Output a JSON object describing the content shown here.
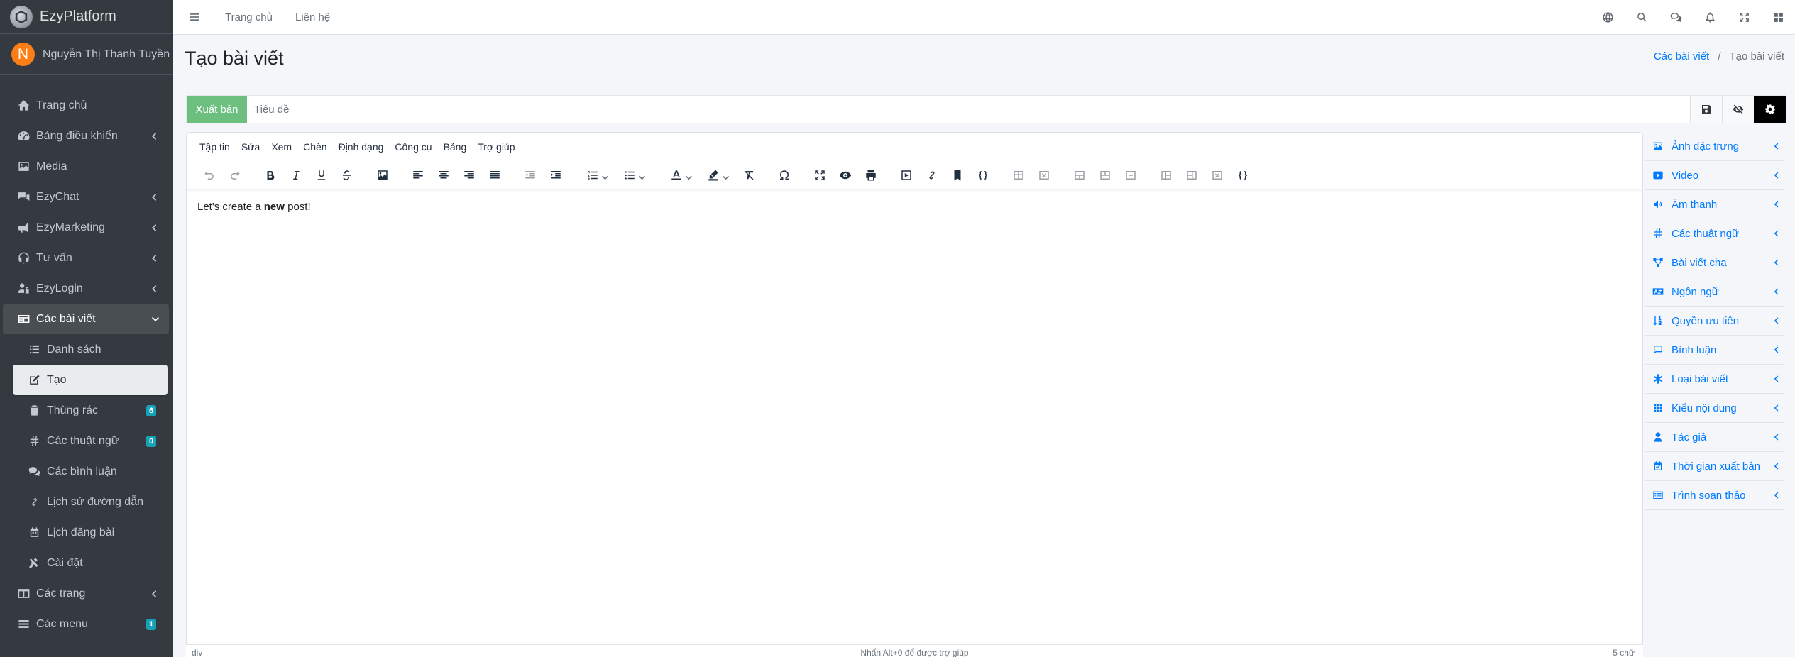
{
  "brand": {
    "name": "EzyPlatform"
  },
  "user": {
    "initial": "N",
    "name": "Nguyễn Thị Thanh Tuyền"
  },
  "sidebar": {
    "items": [
      {
        "label": "Trang chủ",
        "icon": "home-icon"
      },
      {
        "label": "Bảng điều khiển",
        "icon": "dashboard-icon"
      },
      {
        "label": "Media",
        "icon": "image-icon"
      },
      {
        "label": "EzyChat",
        "icon": "chat-icon"
      },
      {
        "label": "EzyMarketing",
        "icon": "megaphone-icon"
      },
      {
        "label": "Tư vấn",
        "icon": "headset-icon"
      },
      {
        "label": "EzyLogin",
        "icon": "user-lock-icon"
      },
      {
        "label": "Các bài viết",
        "icon": "newspaper-icon"
      },
      {
        "label": "Danh sách",
        "icon": "list-icon"
      },
      {
        "label": "Tạo",
        "icon": "edit-icon"
      },
      {
        "label": "Thùng rác",
        "icon": "trash-icon",
        "badge": "6"
      },
      {
        "label": "Các thuật ngữ",
        "icon": "hashtag-icon",
        "badge": "0"
      },
      {
        "label": "Các bình luận",
        "icon": "comments-icon"
      },
      {
        "label": "Lịch sử đường dẫn",
        "icon": "link-icon"
      },
      {
        "label": "Lịch đăng bài",
        "icon": "calendar-icon"
      },
      {
        "label": "Cài đặt",
        "icon": "tools-icon"
      },
      {
        "label": "Các trang",
        "icon": "columns-icon"
      },
      {
        "label": "Các menu",
        "icon": "bars-icon",
        "badge": "1"
      }
    ]
  },
  "topbar": {
    "home": "Trang chủ",
    "contact": "Liên hệ"
  },
  "header": {
    "title": "Tạo bài viết",
    "breadcrumb_link": "Các bài viết",
    "breadcrumb_sep": "/",
    "breadcrumb_current": "Tạo bài viết"
  },
  "post": {
    "publish_label": "Xuất bản",
    "title_placeholder": "Tiêu đề",
    "title_value": ""
  },
  "editor": {
    "menus": [
      "Tập tin",
      "Sửa",
      "Xem",
      "Chèn",
      "Định dạng",
      "Công cụ",
      "Bảng",
      "Trợ giúp"
    ],
    "content_before": "Let's create a ",
    "content_bold": "new",
    "content_after": " post!",
    "status_path": "div",
    "status_help": "Nhấn Alt+0 để được trợ giúp",
    "status_words": "5 chữ"
  },
  "rightpanel": {
    "items": [
      {
        "label": "Ảnh đặc trưng",
        "icon": "image-icon"
      },
      {
        "label": "Video",
        "icon": "youtube-icon"
      },
      {
        "label": "Âm thanh",
        "icon": "volume-icon"
      },
      {
        "label": "Các thuật ngữ",
        "icon": "hashtag-icon"
      },
      {
        "label": "Bài viết cha",
        "icon": "project-diagram-icon"
      },
      {
        "label": "Ngôn ngữ",
        "icon": "language-icon"
      },
      {
        "label": "Quyền ưu tiên",
        "icon": "sort-numeric-icon"
      },
      {
        "label": "Bình luận",
        "icon": "comment-icon"
      },
      {
        "label": "Loại bài viết",
        "icon": "asterisk-icon"
      },
      {
        "label": "Kiểu nội dung",
        "icon": "grid-icon"
      },
      {
        "label": "Tác giả",
        "icon": "user-icon"
      },
      {
        "label": "Thời gian xuất bản",
        "icon": "calendar-check-icon"
      },
      {
        "label": "Trình soạn thảo",
        "icon": "editor-list-icon"
      }
    ]
  },
  "colors": {
    "sidebar_bg": "#343a40",
    "publish_green": "#6cbf7f",
    "link_blue": "#007bff",
    "badge_teal": "#17a2b8"
  }
}
